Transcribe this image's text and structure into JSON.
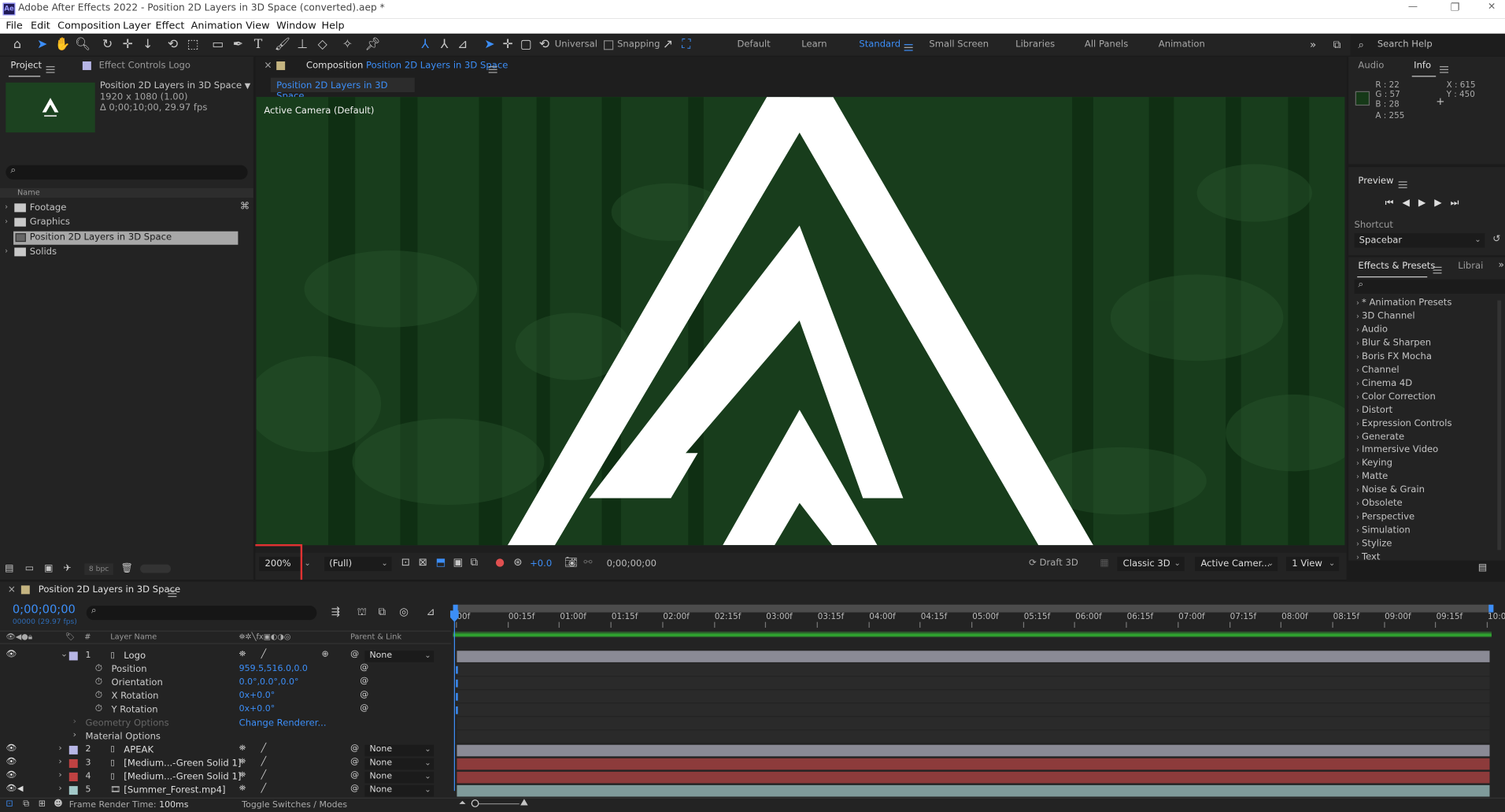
{
  "window": {
    "title": "Adobe After Effects 2022 - Position 2D Layers in 3D Space (converted).aep *",
    "app_icon": "Ae"
  },
  "window_controls": [
    "—",
    "❐",
    "✕"
  ],
  "menu": [
    "File",
    "Edit",
    "Composition",
    "Layer",
    "Effect",
    "Animation",
    "View",
    "Window",
    "Help"
  ],
  "toolbar": {
    "universal": "Universal",
    "snapping": "Snapping",
    "workspaces": [
      "Default",
      "Learn",
      "Standard",
      "Small Screen",
      "Libraries",
      "All Panels",
      "Animation"
    ],
    "active_workspace": "Standard",
    "search_help": "Search Help"
  },
  "project_panel": {
    "tab": "Project",
    "effect_controls_tab": "Effect Controls Logo",
    "comp_name": "Position 2D Layers in 3D Space",
    "comp_res": "1920 x 1080 (1.00)",
    "comp_duration": "Δ 0;00;10;00, 29.97 fps",
    "name_header": "Name",
    "items": [
      {
        "label": "Footage",
        "type": "folder"
      },
      {
        "label": "Graphics",
        "type": "folder"
      },
      {
        "label": "Position 2D Layers in 3D Space",
        "type": "comp",
        "selected": true
      },
      {
        "label": "Solids",
        "type": "folder"
      }
    ],
    "bpc": "8 bpc"
  },
  "composition_panel": {
    "tab_label": "Composition",
    "comp_name": "Position 2D Layers in 3D Space",
    "subtab": "Position 2D Layers in 3D Space",
    "camera": "Active Camera (Default)",
    "zoom": "200%",
    "resolution": "(Full)",
    "exposure": "+0.0",
    "timecode": "0;00;00;00",
    "renderer_label": "Draft 3D",
    "renderer": "Classic 3D",
    "view_camera": "Active Camer...",
    "view_layout": "1 View"
  },
  "info_panel": {
    "audio_tab": "Audio",
    "info_tab": "Info",
    "r": "R : 22",
    "g": "G : 57",
    "b": "B : 28",
    "a": "A : 255",
    "x": "X : 615",
    "y": "Y : 450",
    "swatch_color": "#163918"
  },
  "preview_panel": {
    "tab": "Preview",
    "shortcut_label": "Shortcut",
    "shortcut_value": "Spacebar"
  },
  "effects_panel": {
    "tab": "Effects & Presets",
    "libraries_tab": "Librai",
    "items": [
      "* Animation Presets",
      "3D Channel",
      "Audio",
      "Blur & Sharpen",
      "Boris FX Mocha",
      "Channel",
      "Cinema 4D",
      "Color Correction",
      "Distort",
      "Expression Controls",
      "Generate",
      "Immersive Video",
      "Keying",
      "Matte",
      "Noise & Grain",
      "Obsolete",
      "Perspective",
      "Simulation",
      "Stylize",
      "Text"
    ]
  },
  "timeline": {
    "tab": "Position 2D Layers in 3D Space",
    "timecode": "0;00;00;00",
    "frames": "00000 (29.97 fps)",
    "col_layer_name": "Layer Name",
    "col_parent": "Parent & Link",
    "ticks": [
      "00f",
      "00:15f",
      "01:00f",
      "01:15f",
      "02:00f",
      "02:15f",
      "03:00f",
      "03:15f",
      "04:00f",
      "04:15f",
      "05:00f",
      "05:15f",
      "06:00f",
      "06:15f",
      "07:00f",
      "07:15f",
      "08:00f",
      "08:15f",
      "09:00f",
      "09:15f",
      "10:0"
    ],
    "layers": [
      {
        "num": "1",
        "name": "Logo",
        "color": "#b7b6e6",
        "parent": "None",
        "bar": "#8a8a95"
      },
      {
        "num": "2",
        "name": "APEAK",
        "color": "#b7b6e6",
        "parent": "None",
        "bar": "#8a8a95"
      },
      {
        "num": "3",
        "name": "[Medium...-Green Solid 1]",
        "color": "#c04242",
        "parent": "None",
        "bar": "#8d3b3b"
      },
      {
        "num": "4",
        "name": "[Medium...-Green Solid 1]",
        "color": "#c04242",
        "parent": "None",
        "bar": "#8d3b3b"
      },
      {
        "num": "5",
        "name": "[Summer_Forest.mp4]",
        "color": "#a3c9c9",
        "parent": "None",
        "bar": "#7f9a9a"
      }
    ],
    "properties": [
      {
        "name": "Position",
        "value": "959.5,516.0,0.0"
      },
      {
        "name": "Orientation",
        "value": "0.0°,0.0°,0.0°"
      },
      {
        "name": "X Rotation",
        "value": "0x+0.0°"
      },
      {
        "name": "Y Rotation",
        "value": "0x+0.0°"
      }
    ],
    "geometry_options": "Geometry Options",
    "change_renderer": "Change Renderer...",
    "material_options": "Material Options",
    "frame_render_label": "Frame Render Time:",
    "frame_render_value": "100ms",
    "toggle_label": "Toggle Switches / Modes"
  }
}
